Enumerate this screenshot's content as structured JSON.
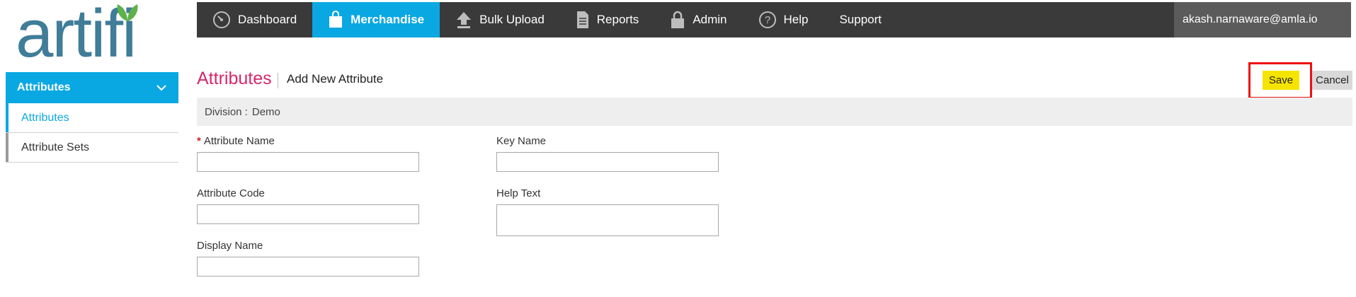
{
  "brand": {
    "logo_text": "artifi",
    "logo_color": "#3f7d99",
    "leaf_color": "#5fb14a"
  },
  "topnav": {
    "items": [
      {
        "label": "Dashboard",
        "icon": "dashboard-gauge-icon"
      },
      {
        "label": "Merchandise",
        "icon": "shopping-bag-icon",
        "active": true
      },
      {
        "label": "Bulk Upload",
        "icon": "upload-icon"
      },
      {
        "label": "Reports",
        "icon": "document-icon"
      },
      {
        "label": "Admin",
        "icon": "lock-icon"
      },
      {
        "label": "Help",
        "icon": "help-circle-icon"
      },
      {
        "label": "Support",
        "icon": ""
      }
    ],
    "user_email": "akash.narnaware@amla.io",
    "accent": "#0aa8e2"
  },
  "sidebar": {
    "header": "Attributes",
    "items": [
      {
        "label": "Attributes",
        "active": true
      },
      {
        "label": "Attribute Sets",
        "active": false
      }
    ]
  },
  "main": {
    "title": "Attributes",
    "subtitle": "Add New Attribute",
    "save_label": "Save",
    "cancel_label": "Cancel",
    "division_label": "Division :",
    "division_value": "Demo"
  },
  "form": {
    "attribute_name": {
      "label": "Attribute Name",
      "required_mark": "*",
      "value": ""
    },
    "key_name": {
      "label": "Key Name",
      "value": ""
    },
    "attribute_code": {
      "label": "Attribute Code",
      "value": ""
    },
    "help_text": {
      "label": "Help Text",
      "value": ""
    },
    "display_name": {
      "label": "Display Name",
      "value": ""
    }
  },
  "colors": {
    "title_pink": "#d6286a",
    "save_yellow": "#f5e400",
    "highlight_red": "#ee1111",
    "nav_bg": "#3a3a3a"
  }
}
